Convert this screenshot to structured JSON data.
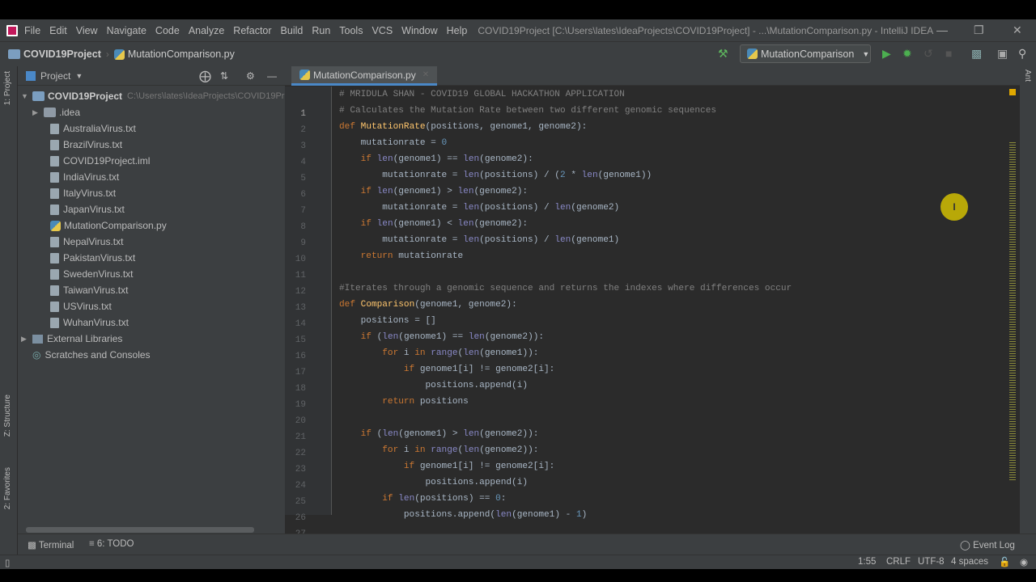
{
  "menu": {
    "items": [
      "File",
      "Edit",
      "View",
      "Navigate",
      "Code",
      "Analyze",
      "Refactor",
      "Build",
      "Run",
      "Tools",
      "VCS",
      "Window",
      "Help"
    ],
    "title": "COVID19Project [C:\\Users\\lates\\IdeaProjects\\COVID19Project] - ...\\MutationComparison.py - IntelliJ IDEA"
  },
  "breadcrumb": [
    "COVID19Project",
    "MutationComparison.py"
  ],
  "run_config": "MutationComparison",
  "side_tabs": {
    "project": "1: Project",
    "structure": "Z: Structure",
    "favorites": "2: Favorites",
    "ant": "Ant"
  },
  "project_panel": {
    "title": "Project",
    "root": "COVID19Project",
    "root_path": "C:\\Users\\lates\\IdeaProjects\\COVID19Project",
    "items": [
      ".idea",
      "AustraliaVirus.txt",
      "BrazilVirus.txt",
      "COVID19Project.iml",
      "IndiaVirus.txt",
      "ItalyVirus.txt",
      "JapanVirus.txt",
      "MutationComparison.py",
      "NepalVirus.txt",
      "PakistanVirus.txt",
      "SwedenVirus.txt",
      "TaiwanVirus.txt",
      "USVirus.txt",
      "WuhanVirus.txt"
    ],
    "external": "External Libraries",
    "scratches": "Scratches and Consoles"
  },
  "editor": {
    "tab": "MutationComparison.py",
    "lines": [
      "# MRIDULA SHAN - COVID19 GLOBAL HACKATHON APPLICATION",
      "# Calculates the Mutation Rate between two different genomic sequences",
      "def MutationRate(positions, genome1, genome2):",
      "    mutationrate = 0",
      "    if len(genome1) == len(genome2):",
      "        mutationrate = len(positions) / (2 * len(genome1))",
      "    if len(genome1) > len(genome2):",
      "        mutationrate = len(positions) / len(genome2)",
      "    if len(genome1) < len(genome2):",
      "        mutationrate = len(positions) / len(genome1)",
      "    return mutationrate",
      "",
      "#Iterates through a genomic sequence and returns the indexes where differences occur",
      "def Comparison(genome1, genome2):",
      "    positions = []",
      "    if (len(genome1) == len(genome2)):",
      "        for i in range(len(genome1)):",
      "            if genome1[i] != genome2[i]:",
      "                positions.append(i)",
      "        return positions",
      "",
      "    if (len(genome1) > len(genome2)):",
      "        for i in range(len(genome2)):",
      "            if genome1[i] != genome2[i]:",
      "                positions.append(i)",
      "        if len(positions) == 0:",
      "            positions.append(len(genome1) - 1)"
    ]
  },
  "bottom_tabs": {
    "terminal": "Terminal",
    "todo": "6: TODO",
    "event_log": "Event Log"
  },
  "status": {
    "position": "1:55",
    "line_sep": "CRLF",
    "encoding": "UTF-8",
    "indent": "4 spaces"
  }
}
